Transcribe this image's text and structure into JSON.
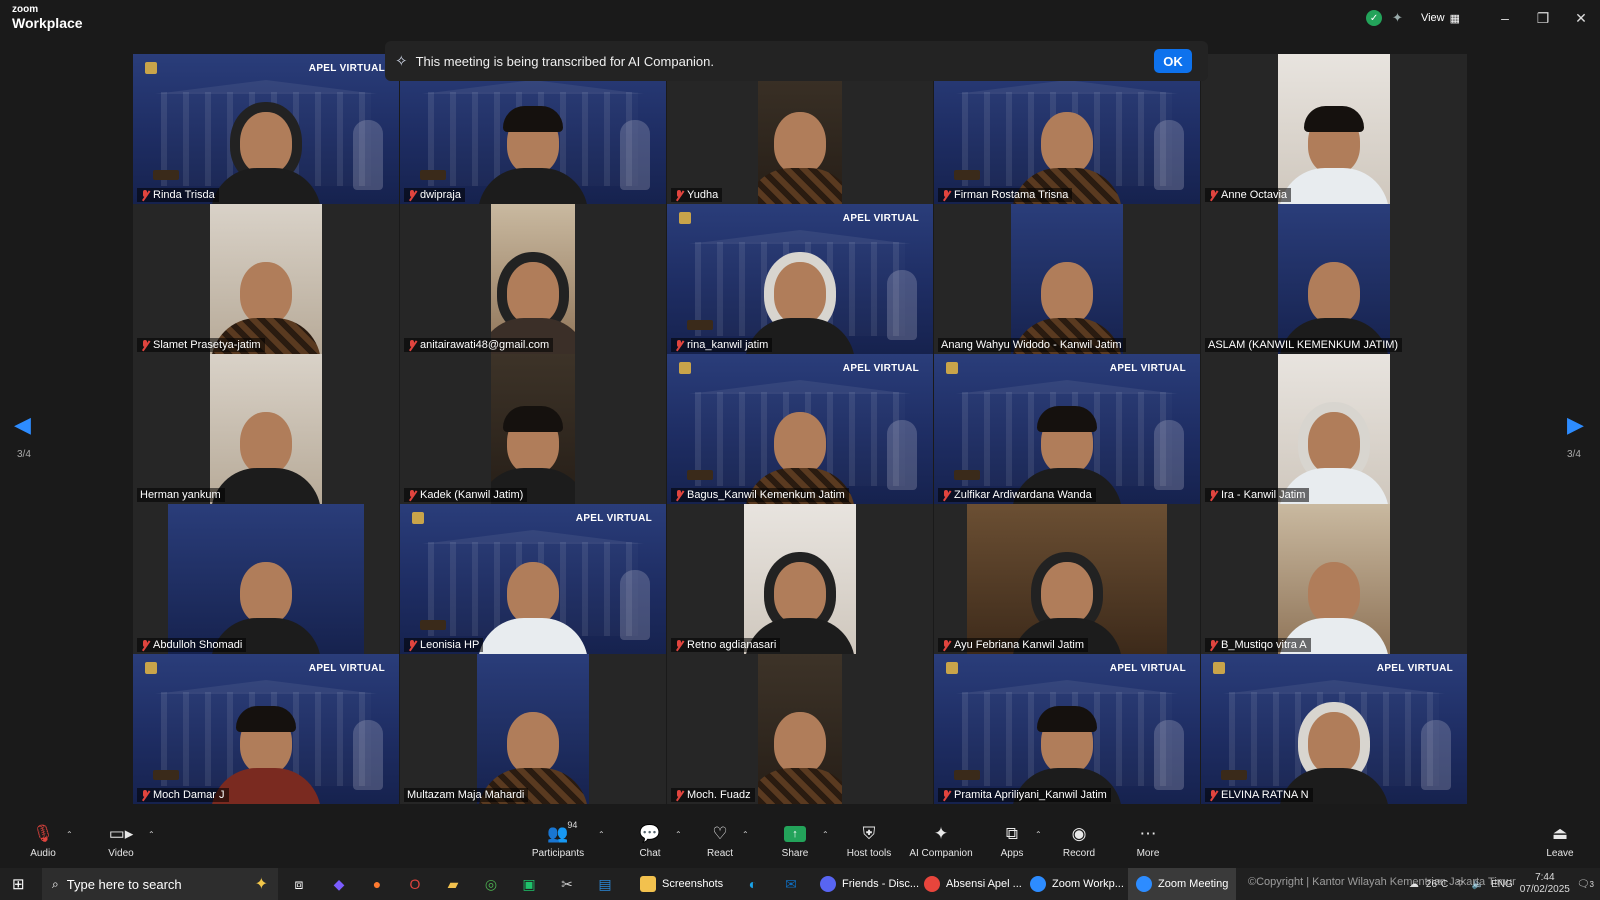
{
  "app": {
    "brand_small": "zoom",
    "brand_large": "Workplace"
  },
  "window": {
    "view_label": "View"
  },
  "banner": {
    "message": "This meeting is being transcribed for AI Companion.",
    "ok_label": "OK"
  },
  "pagination": {
    "left": "3/4",
    "right": "3/4"
  },
  "background": {
    "apel_label": "APEL VIRTUAL"
  },
  "participants": [
    {
      "name": "Rinda Trisda",
      "muted": true
    },
    {
      "name": "dwipraja",
      "muted": true
    },
    {
      "name": "Yudha",
      "muted": true
    },
    {
      "name": "Firman Rostama Trisna",
      "muted": true
    },
    {
      "name": "Anne Octavia",
      "muted": true
    },
    {
      "name": "Slamet Prasetya-jatim",
      "muted": true
    },
    {
      "name": "anitairawati48@gmail.com",
      "muted": true
    },
    {
      "name": "rina_kanwil jatim",
      "muted": true
    },
    {
      "name": "Anang Wahyu Widodo - Kanwil Jatim",
      "muted": false
    },
    {
      "name": "ASLAM (KANWIL KEMENKUM JATIM)",
      "muted": false
    },
    {
      "name": "Herman yankum",
      "muted": false
    },
    {
      "name": "Kadek (Kanwil Jatim)",
      "muted": true
    },
    {
      "name": "Bagus_Kanwil Kemenkum Jatim",
      "muted": true
    },
    {
      "name": "Zulfikar Ardiwardana Wanda",
      "muted": true
    },
    {
      "name": "Ira - Kanwil Jatim",
      "muted": true
    },
    {
      "name": "Abdulloh Shomadi",
      "muted": true
    },
    {
      "name": "Leonisia HP",
      "muted": true
    },
    {
      "name": "Retno agdianasari",
      "muted": true
    },
    {
      "name": "Ayu Febriana Kanwil Jatim",
      "muted": true
    },
    {
      "name": "B_Mustiqo vitra A",
      "muted": true
    },
    {
      "name": "Moch Damar J",
      "muted": true
    },
    {
      "name": "Multazam Maja Mahardi",
      "muted": false
    },
    {
      "name": "Moch. Fuadz",
      "muted": true
    },
    {
      "name": "Pramita Apriliyani_Kanwil Jatim",
      "muted": true
    },
    {
      "name": "ELVINA RATNA N",
      "muted": true
    }
  ],
  "toolbar": {
    "audio": "Audio",
    "video": "Video",
    "participants": "Participants",
    "participants_count": "94",
    "chat": "Chat",
    "react": "React",
    "share": "Share",
    "host_tools": "Host tools",
    "ai_companion": "AI Companion",
    "apps": "Apps",
    "record": "Record",
    "more": "More",
    "leave": "Leave"
  },
  "taskbar": {
    "search_placeholder": "Type here to search",
    "items": [
      {
        "label": "Screenshots",
        "color": "#f2c14e"
      },
      {
        "label": "Friends - Disc...",
        "color": "#5865f2"
      },
      {
        "label": "Absensi Apel ...",
        "color": "#e8453c"
      },
      {
        "label": "Zoom Workp...",
        "color": "#2d8cff"
      },
      {
        "label": "Zoom Meeting",
        "color": "#2d8cff"
      }
    ],
    "weather": "26°C",
    "language": "ENG",
    "time": "7:44",
    "date": "07/02/2025",
    "overlay": "©Copyright | Kantor Wilayah Kementrian Jakarta Timur",
    "notif_count": "3"
  },
  "colors": {
    "accent": "#0e72ed",
    "muted_red": "#e0443e",
    "share_green": "#23a35a"
  }
}
